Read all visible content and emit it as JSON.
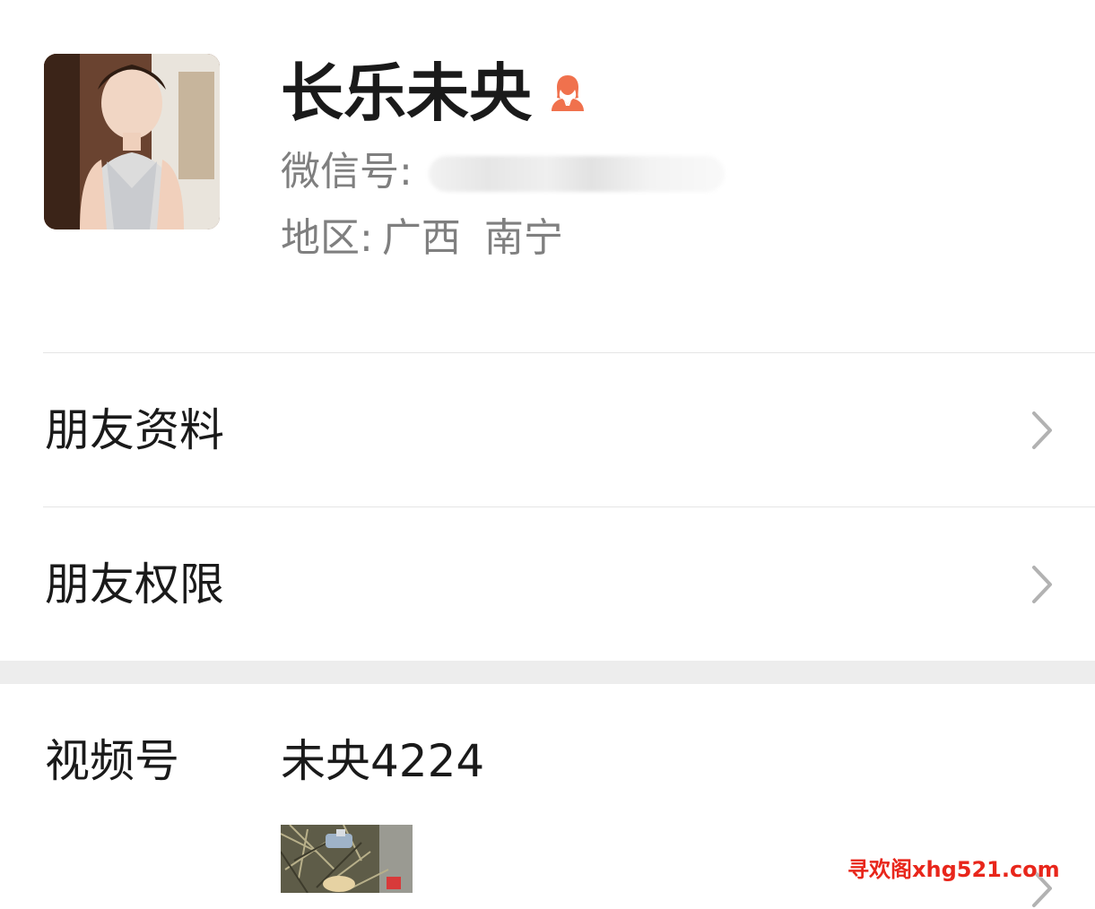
{
  "profile": {
    "name": "长乐未央",
    "wechat_id_label": "微信号:",
    "region_label": "地区:",
    "region_province": "广西",
    "region_city": "南宁",
    "gender_icon": "female-icon",
    "gender_color": "#f0714d"
  },
  "menu": {
    "friend_profile_label": "朋友资料",
    "friend_permissions_label": "朋友权限"
  },
  "channels": {
    "label": "视频号",
    "value": "未央4224"
  },
  "watermark": {
    "text": "寻欢阁xhg521.com",
    "color": "#e8261b"
  }
}
